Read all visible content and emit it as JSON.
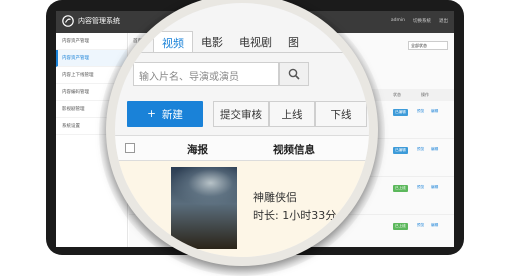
{
  "app": {
    "title": "内容管理系统",
    "user": "admin",
    "links": [
      "切换系统",
      "退出"
    ]
  },
  "sidebar": {
    "items": [
      {
        "label": "内容资产管理",
        "active": false
      },
      {
        "label": "内容资产管理",
        "active": true
      },
      {
        "label": "内容上下线管理",
        "active": false
      },
      {
        "label": "内容编码管理",
        "active": false
      },
      {
        "label": "影视剧管理",
        "active": false
      },
      {
        "label": "系统设置",
        "active": false
      }
    ]
  },
  "content": {
    "breadcrumb": "首页",
    "status_filter": "全部状态",
    "headers": [
      "状态",
      "操作"
    ],
    "rows": [
      {
        "status": "已编辑",
        "status_color": "#3d9bd9",
        "ops": [
          "预览",
          "编辑"
        ]
      },
      {
        "status": "已编辑",
        "status_color": "#3d9bd9",
        "ops": [
          "预览",
          "编辑"
        ]
      },
      {
        "status": "已编辑",
        "status_color": "#3d9bd9",
        "ops": [
          "预览",
          "编辑"
        ]
      },
      {
        "status": "已上线",
        "status_color": "#5cb85c",
        "ops": [
          "预览",
          "编辑"
        ]
      },
      {
        "status": "已上线",
        "status_color": "#5cb85c",
        "ops": [
          "预览",
          "编辑"
        ]
      }
    ]
  },
  "magnifier": {
    "tabs": [
      "视频",
      "电影",
      "电视剧",
      "图"
    ],
    "active_tab": "视频",
    "search_placeholder": "输入片名、导演或演员",
    "new_button": "新建",
    "action_buttons": [
      "提交审核",
      "上线",
      "下线"
    ],
    "table_headers": {
      "poster": "海报",
      "info": "视频信息"
    },
    "row": {
      "title": "神雕侠侣",
      "duration": "时长: 1小时33分"
    }
  },
  "colors": {
    "accent": "#1a82d8",
    "row_highlight": "#fdf6e7"
  }
}
